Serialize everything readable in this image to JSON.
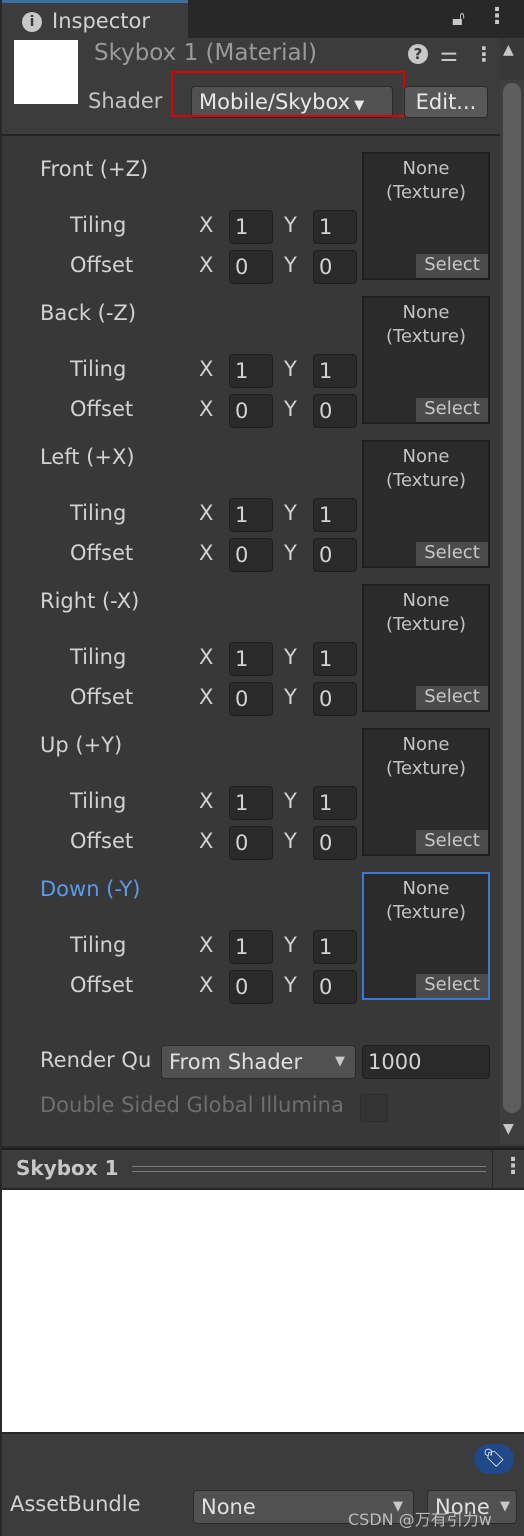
{
  "tab": {
    "title": "Inspector",
    "icon": "info-icon"
  },
  "header": {
    "title": "Skybox 1 (Material)",
    "shader_label": "Shader",
    "shader_value": "Mobile/Skybox",
    "edit_label": "Edit...",
    "highlight_color": "#e00000"
  },
  "texture": {
    "none_line1": "None",
    "none_line2": "(Texture)",
    "select": "Select"
  },
  "labels": {
    "tiling": "Tiling",
    "offset": "Offset",
    "x": "X",
    "y": "Y"
  },
  "sections": [
    {
      "label": "Front (+Z)",
      "tiling_x": "1",
      "tiling_y": "1",
      "offset_x": "0",
      "offset_y": "0"
    },
    {
      "label": "Back (-Z)",
      "tiling_x": "1",
      "tiling_y": "1",
      "offset_x": "0",
      "offset_y": "0"
    },
    {
      "label": "Left (+X)",
      "tiling_x": "1",
      "tiling_y": "1",
      "offset_x": "0",
      "offset_y": "0"
    },
    {
      "label": "Right (-X)",
      "tiling_x": "1",
      "tiling_y": "1",
      "offset_x": "0",
      "offset_y": "0"
    },
    {
      "label": "Up (+Y)",
      "tiling_x": "1",
      "tiling_y": "1",
      "offset_x": "0",
      "offset_y": "0"
    },
    {
      "label": "Down (-Y)",
      "tiling_x": "1",
      "tiling_y": "1",
      "offset_x": "0",
      "offset_y": "0",
      "selected": true
    }
  ],
  "selected_color": "#5b9bea",
  "render_queue": {
    "label": "Render Qu",
    "mode": "From Shader",
    "value": "1000"
  },
  "double_sided": {
    "label": "Double Sided Global Illumina",
    "checked": false
  },
  "preview": {
    "title": "Skybox 1"
  },
  "asset_bundle": {
    "label": "AssetBundle",
    "bundle": "None",
    "variant": "None"
  },
  "watermark": "CSDN @万有引力w"
}
